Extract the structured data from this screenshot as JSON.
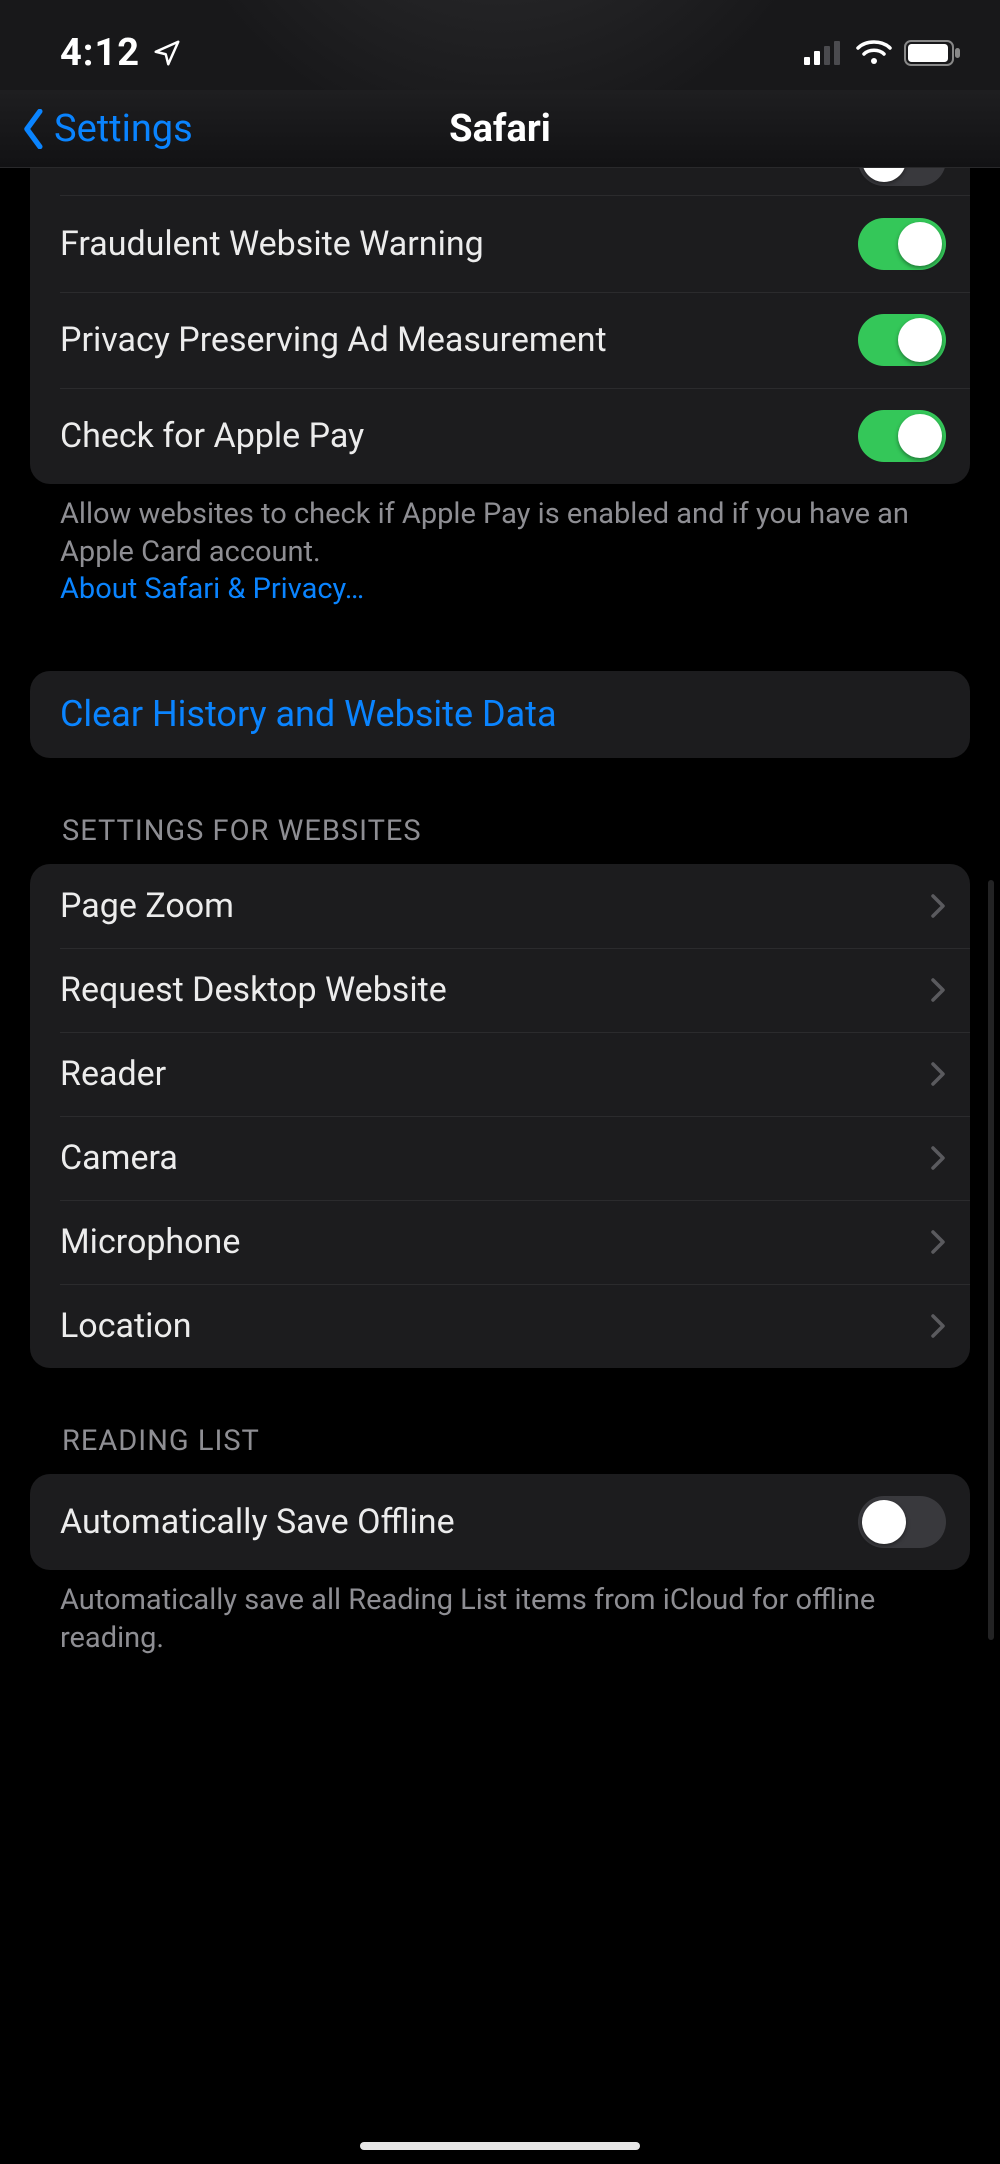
{
  "statusbar": {
    "time": "4:12"
  },
  "nav": {
    "back": "Settings",
    "title": "Safari"
  },
  "privacy_group": {
    "fraud": "Fraudulent Website Warning",
    "ppam": "Privacy Preserving Ad Measurement",
    "applepay": "Check for Apple Pay"
  },
  "privacy_footer": {
    "text": "Allow websites to check if Apple Pay is enabled and if you have an Apple Card account.",
    "link": "About Safari & Privacy…"
  },
  "clear_action": "Clear History and Website Data",
  "websites_header": "SETTINGS FOR WEBSITES",
  "websites": {
    "zoom": "Page Zoom",
    "desktop": "Request Desktop Website",
    "reader": "Reader",
    "camera": "Camera",
    "microphone": "Microphone",
    "location": "Location"
  },
  "readinglist_header": "READING LIST",
  "readinglist": {
    "autosave": "Automatically Save Offline"
  },
  "readinglist_footer": "Automatically save all Reading List items from iCloud for offline reading."
}
